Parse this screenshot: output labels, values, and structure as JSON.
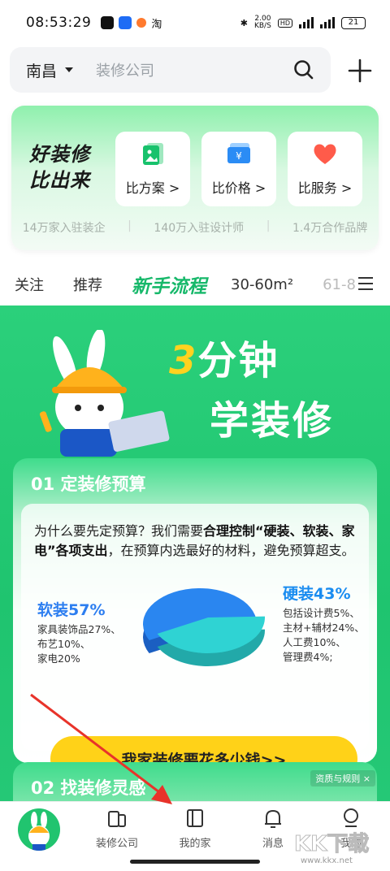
{
  "status_bar": {
    "time": "08:53:29",
    "net_speed": "2.00",
    "net_unit": "KB/S",
    "battery": "21"
  },
  "search": {
    "city": "南昌",
    "placeholder": "装修公司"
  },
  "compare": {
    "slogan_line1": "好装修",
    "slogan_line2": "比出来",
    "cards": [
      {
        "label": "比方案 >",
        "icon": "plan-icon"
      },
      {
        "label": "比价格 >",
        "icon": "price-icon"
      },
      {
        "label": "比服务 >",
        "icon": "heart-icon"
      }
    ],
    "stats": [
      "14万家入驻装企",
      "140万入驻设计师",
      "1.4万合作品牌"
    ]
  },
  "tabs": [
    {
      "label": "关注"
    },
    {
      "label": "推荐"
    },
    {
      "label": "新手流程",
      "active": true
    },
    {
      "label": "30-60m²"
    },
    {
      "label": "61-8"
    }
  ],
  "banner": {
    "headline_num": "3",
    "headline_rest": "分钟",
    "headline_line2": "学装修",
    "section1": {
      "title": "01 定装修预算",
      "desc_pre": "为什么要先定预算？我们需要",
      "desc_bold": "合理控制“硬装、软装、家电”各项支出",
      "desc_post": "，在预算内选最好的材料，避免预算超支。",
      "soft_title": "软装57%",
      "soft_items": [
        "家具装饰品27%、",
        "布艺10%、",
        "家电20%"
      ],
      "hard_title": "硬装43%",
      "hard_items": [
        "包括设计费5%、",
        "主材+辅材24%、",
        "人工费10%、",
        "管理费4%;"
      ],
      "cta": "我家装修要花多少钱>>"
    },
    "section2": {
      "title": "02 找装修灵感",
      "ad_tag": "资质与规则"
    }
  },
  "chart_data": {
    "type": "pie",
    "categories": [
      "软装",
      "硬装"
    ],
    "values": [
      57,
      43
    ]
  },
  "bottom_nav": {
    "items": [
      {
        "label": "装修公司"
      },
      {
        "label": "我的家"
      },
      {
        "label": "消息"
      },
      {
        "label": "我的"
      }
    ]
  },
  "watermark": {
    "text": "KK下载",
    "url": "www.kkx.net"
  },
  "colors": {
    "brand_green": "#1fc46f",
    "cta_yellow": "#ffd218",
    "soft_blue": "#2d7ef0",
    "hard_cyan": "#2fd3d3"
  }
}
